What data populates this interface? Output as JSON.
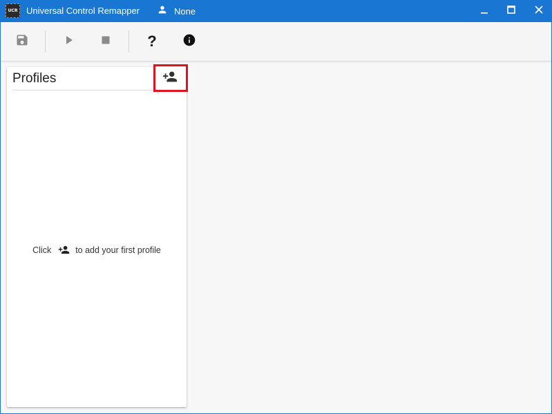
{
  "window": {
    "app_icon_text": "UCR",
    "title": "Universal Control Remapper",
    "user_label": "None",
    "controls": {
      "minimize_icon": "minimize-icon",
      "maximize_icon": "maximize-icon",
      "close_icon": "close-icon"
    }
  },
  "toolbar": {
    "items": [
      {
        "name": "save",
        "icon": "floppy-disk-icon",
        "enabled": false
      },
      {
        "name": "start",
        "icon": "play-icon",
        "enabled": false
      },
      {
        "name": "stop",
        "icon": "stop-icon",
        "enabled": false
      },
      {
        "name": "help",
        "icon": "question-mark-icon",
        "enabled": true
      },
      {
        "name": "about",
        "icon": "info-circle-icon",
        "enabled": true
      }
    ],
    "help_glyph": "?"
  },
  "profiles": {
    "title": "Profiles",
    "add_icon": "add-user-icon",
    "empty_hint_before": "Click",
    "empty_hint_after": "to add your first profile"
  },
  "colors": {
    "titlebar": "#1976d2",
    "toolbar": "#f5f5f5",
    "background": "#f7f7f7",
    "highlight": "#e0141e",
    "icon_enabled": "#1a1a1a",
    "icon_disabled": "#8a8a8a"
  }
}
